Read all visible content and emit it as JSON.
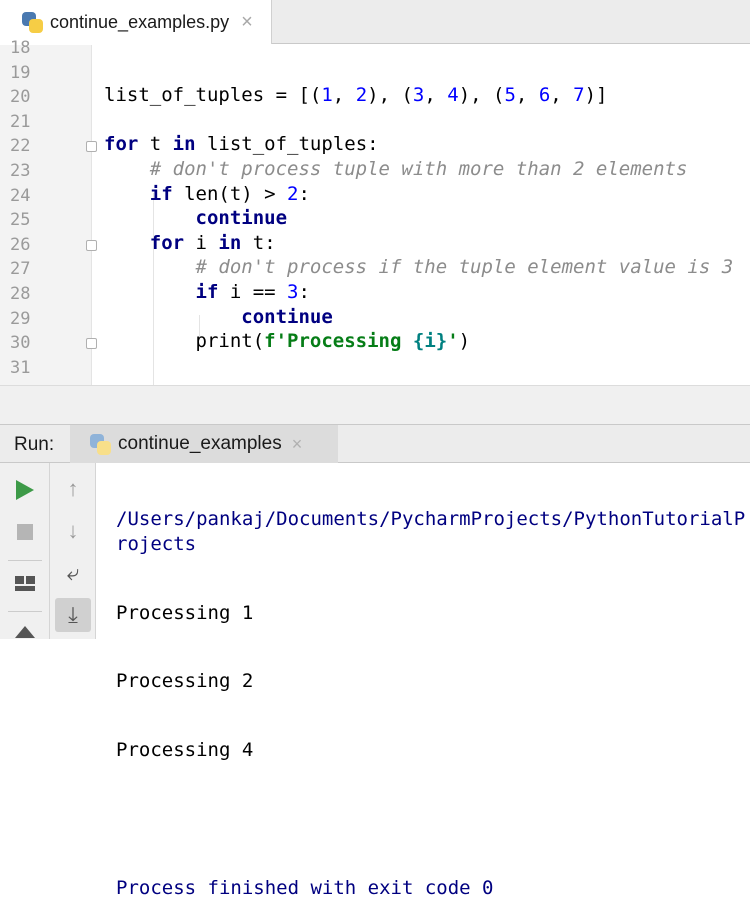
{
  "editor_tab": {
    "filename": "continue_examples.py",
    "close": "×"
  },
  "line_numbers": [
    "18",
    "19",
    "20",
    "21",
    "22",
    "23",
    "24",
    "25",
    "26",
    "27",
    "28",
    "29",
    "30",
    "31"
  ],
  "code_lines": [
    [],
    [],
    [
      [
        "list_of_tuples = [(",
        ""
      ],
      [
        "1",
        "num"
      ],
      [
        ", ",
        ""
      ],
      [
        "2",
        "num"
      ],
      [
        "), (",
        ""
      ],
      [
        "3",
        "num"
      ],
      [
        ", ",
        ""
      ],
      [
        "4",
        "num"
      ],
      [
        "), (",
        ""
      ],
      [
        "5",
        "num"
      ],
      [
        ", ",
        ""
      ],
      [
        "6",
        "num"
      ],
      [
        ", ",
        ""
      ],
      [
        "7",
        "num"
      ],
      [
        ")]",
        ""
      ]
    ],
    [],
    [
      [
        "for",
        "kw"
      ],
      [
        " t ",
        ""
      ],
      [
        "in",
        "kw"
      ],
      [
        " list_of_tuples:",
        ""
      ]
    ],
    [
      [
        "    ",
        ""
      ],
      [
        "# don't process tuple with more than 2 elements",
        "cm"
      ]
    ],
    [
      [
        "    ",
        ""
      ],
      [
        "if",
        "kw"
      ],
      [
        " len(t) > ",
        ""
      ],
      [
        "2",
        "num"
      ],
      [
        ":",
        ""
      ]
    ],
    [
      [
        "        ",
        ""
      ],
      [
        "continue",
        "kw"
      ]
    ],
    [
      [
        "    ",
        ""
      ],
      [
        "for",
        "kw"
      ],
      [
        " i ",
        ""
      ],
      [
        "in",
        "kw"
      ],
      [
        " t:",
        ""
      ]
    ],
    [
      [
        "        ",
        ""
      ],
      [
        "# don't process if the tuple element value is 3",
        "cm"
      ]
    ],
    [
      [
        "        ",
        ""
      ],
      [
        "if",
        "kw"
      ],
      [
        " i == ",
        ""
      ],
      [
        "3",
        "num"
      ],
      [
        ":",
        ""
      ]
    ],
    [
      [
        "            ",
        ""
      ],
      [
        "continue",
        "kw"
      ]
    ],
    [
      [
        "        print(",
        ""
      ],
      [
        "f'Processing ",
        "str"
      ],
      [
        "{i}",
        "fs"
      ],
      [
        "'",
        "str"
      ],
      [
        ")",
        ""
      ]
    ],
    []
  ],
  "run_panel": {
    "label": "Run:",
    "tab": "continue_examples",
    "close": "×",
    "output": [
      "/Users/pankaj/Documents/PycharmProjects/PythonTutorialProjects",
      "Processing 1",
      "Processing 2",
      "Processing 4",
      "",
      "Process finished with exit code 0"
    ]
  }
}
